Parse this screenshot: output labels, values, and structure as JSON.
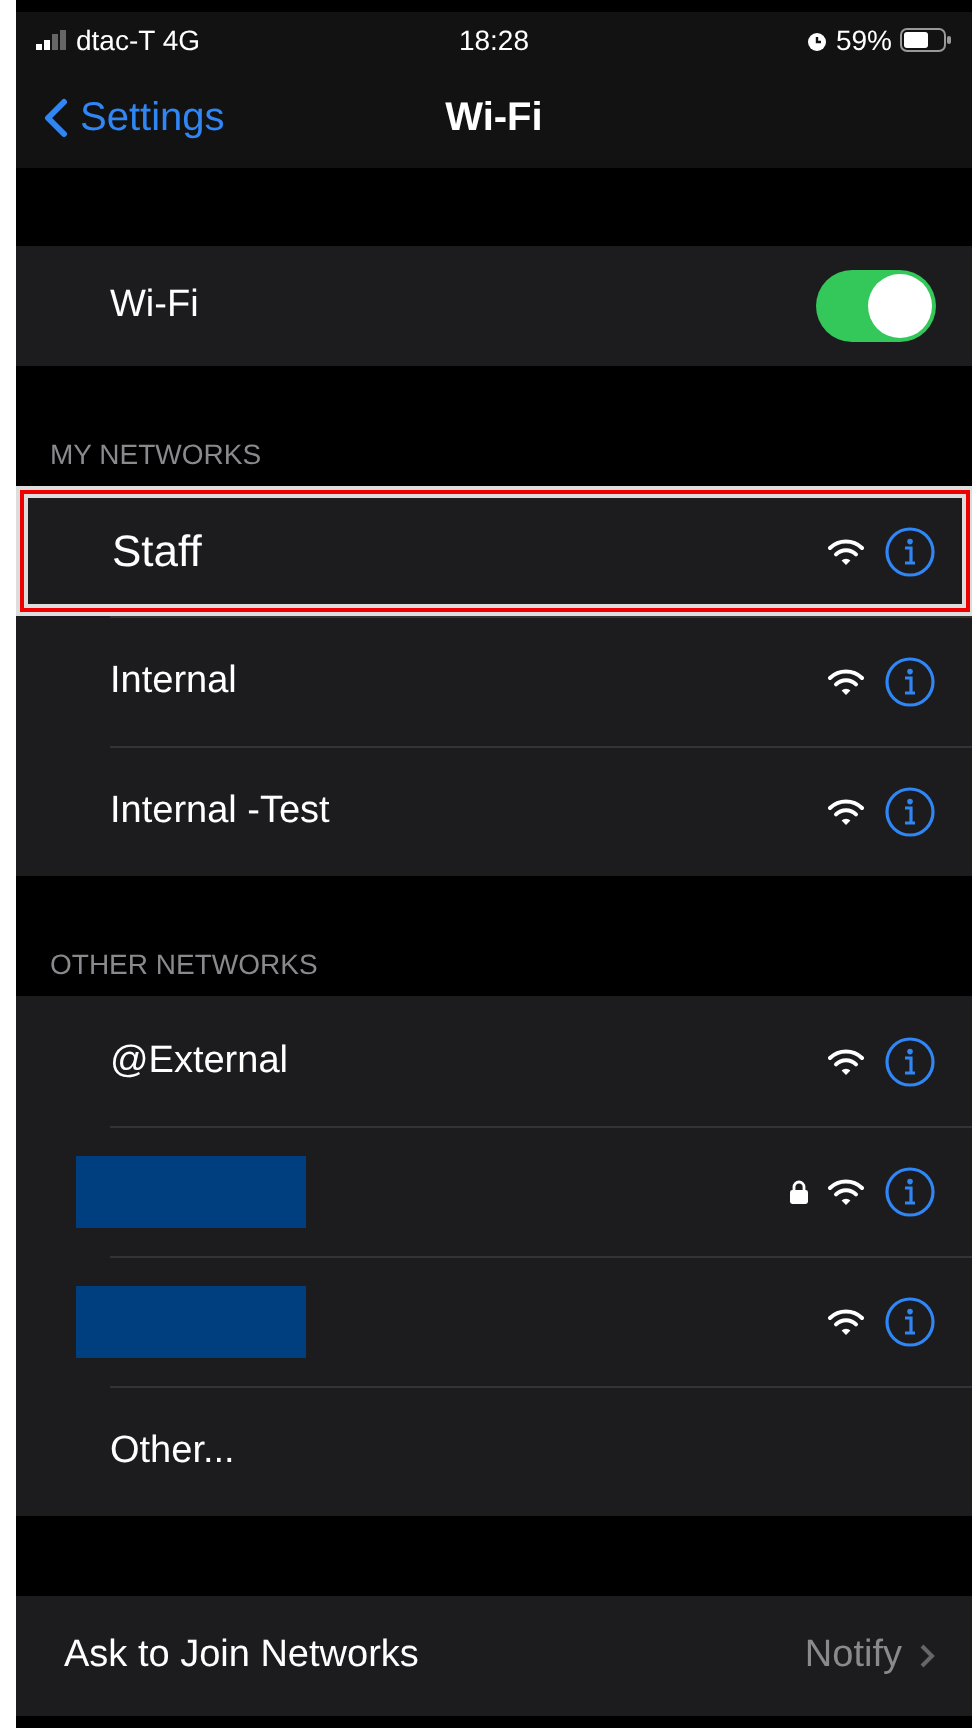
{
  "status_bar": {
    "carrier": "dtac-T 4G",
    "time": "18:28",
    "battery": "59%"
  },
  "nav": {
    "back": "Settings",
    "title": "Wi-Fi"
  },
  "wifi": {
    "label": "Wi-Fi",
    "on": true
  },
  "sections": [
    {
      "header": "MY NETWORKS",
      "networks": [
        {
          "kind": "named",
          "name": "Staff",
          "locked": false,
          "highlighted": true
        },
        {
          "kind": "named",
          "name": "Internal",
          "locked": false,
          "highlighted": false
        },
        {
          "kind": "named",
          "name": "Internal -Test",
          "locked": false,
          "highlighted": false
        }
      ]
    },
    {
      "header": "OTHER NETWORKS",
      "networks": [
        {
          "kind": "named",
          "name": "@External",
          "locked": false,
          "highlighted": false
        },
        {
          "kind": "redacted",
          "locked": true,
          "highlighted": false
        },
        {
          "kind": "redacted",
          "locked": false,
          "highlighted": false
        },
        {
          "kind": "other",
          "name": "Other...",
          "highlighted": false
        }
      ]
    }
  ],
  "ask_to_join": {
    "label": "Ask to Join Networks",
    "value": "Notify"
  }
}
